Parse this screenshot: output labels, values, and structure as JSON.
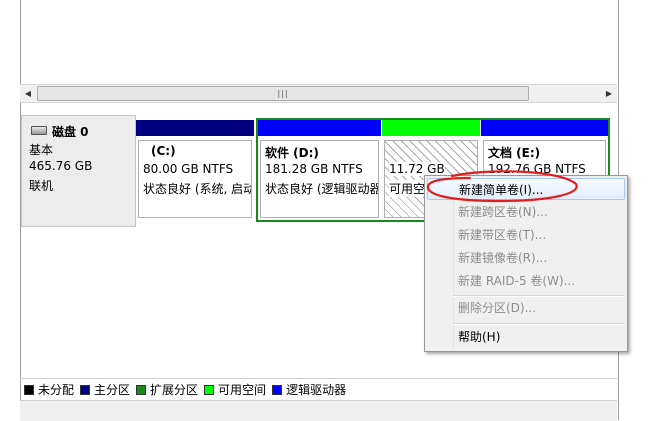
{
  "scroll": {
    "grip": "|||"
  },
  "disk": {
    "name": "磁盘 0",
    "type": "基本",
    "size": "465.76 GB",
    "state": "联机"
  },
  "partitions": [
    {
      "name": "(C:)",
      "size": "80.00 GB NTFS",
      "status": "状态良好 (系统, 启动",
      "header_color": "#000080"
    },
    {
      "name": "软件 (D:)",
      "size": "181.28 GB NTFS",
      "status": "状态良好 (逻辑驱动器",
      "header_color": "#0000ff"
    },
    {
      "name": "",
      "size": "11.72 GB",
      "status": "可用空间",
      "header_color": "#00ff00"
    },
    {
      "name": "文档 (E:)",
      "size": "192.76 GB NTFS",
      "status": "",
      "header_color": "#0000ff"
    }
  ],
  "context_menu": {
    "items": [
      {
        "label": "新建简单卷(I)...",
        "enabled": true
      },
      {
        "label": "新建跨区卷(N)...",
        "enabled": false
      },
      {
        "label": "新建带区卷(T)...",
        "enabled": false
      },
      {
        "label": "新建镜像卷(R)...",
        "enabled": false
      },
      {
        "label": "新建 RAID-5 卷(W)...",
        "enabled": false
      },
      {
        "label": "删除分区(D)...",
        "enabled": false
      },
      {
        "label": "帮助(H)",
        "enabled": true
      }
    ]
  },
  "legend": [
    {
      "label": "未分配",
      "color": "#000000"
    },
    {
      "label": "主分区",
      "color": "#000080"
    },
    {
      "label": "扩展分区",
      "color": "#188a1a"
    },
    {
      "label": "可用空间",
      "color": "#00ff00"
    },
    {
      "label": "逻辑驱动器",
      "color": "#0000ff"
    }
  ],
  "colors": {
    "annotation": "#e02020",
    "extended_border": "#188a1a"
  }
}
